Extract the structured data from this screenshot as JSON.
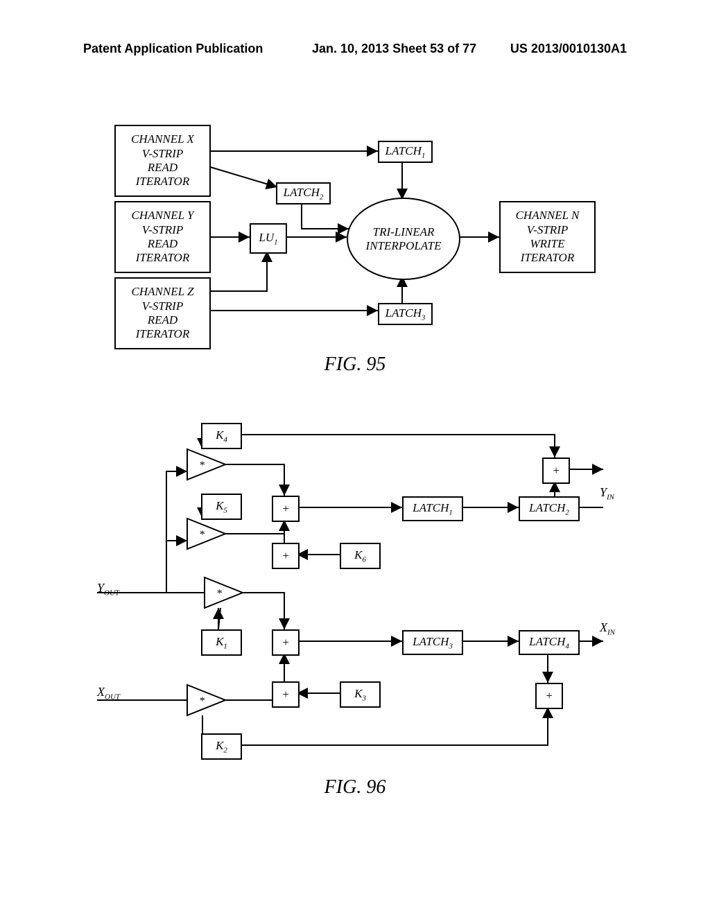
{
  "header": {
    "left": "Patent Application Publication",
    "mid": "Jan. 10, 2013  Sheet 53 of 77",
    "right": "US 2013/0010130A1"
  },
  "fig95": {
    "chx": "CHANNEL X\nV-STRIP\nREAD\nITERATOR",
    "chy": "CHANNEL Y\nV-STRIP\nREAD\nITERATOR",
    "chz": "CHANNEL Z\nV-STRIP\nREAD\nITERATOR",
    "chn": "CHANNEL N\nV-STRIP\nWRITE\nITERATOR",
    "latch1": "LATCH",
    "latch1_sub": "1",
    "latch2": "LATCH",
    "latch2_sub": "2",
    "latch3": "LATCH",
    "latch3_sub": "3",
    "lu1": "LU",
    "lu1_sub": "1",
    "interp": "TRI-LINEAR\nINTERPOLATE",
    "caption": "FIG. 95"
  },
  "fig96": {
    "k1": "K",
    "k1_sub": "1",
    "k2": "K",
    "k2_sub": "2",
    "k3": "K",
    "k3_sub": "3",
    "k4": "K",
    "k4_sub": "4",
    "k5": "K",
    "k5_sub": "5",
    "k6": "K",
    "k6_sub": "6",
    "latch1": "LATCH",
    "latch1_sub": "1",
    "latch2": "LATCH",
    "latch2_sub": "2",
    "latch3": "LATCH",
    "latch3_sub": "3",
    "latch4": "LATCH",
    "latch4_sub": "4",
    "yout": "Y",
    "yout_sub": "OUT",
    "xout": "X",
    "xout_sub": "OUT",
    "yin": "Y",
    "yin_sub": "IN",
    "xin": "X",
    "xin_sub": "IN",
    "plus": "+",
    "mult": "*",
    "caption": "FIG. 96"
  }
}
